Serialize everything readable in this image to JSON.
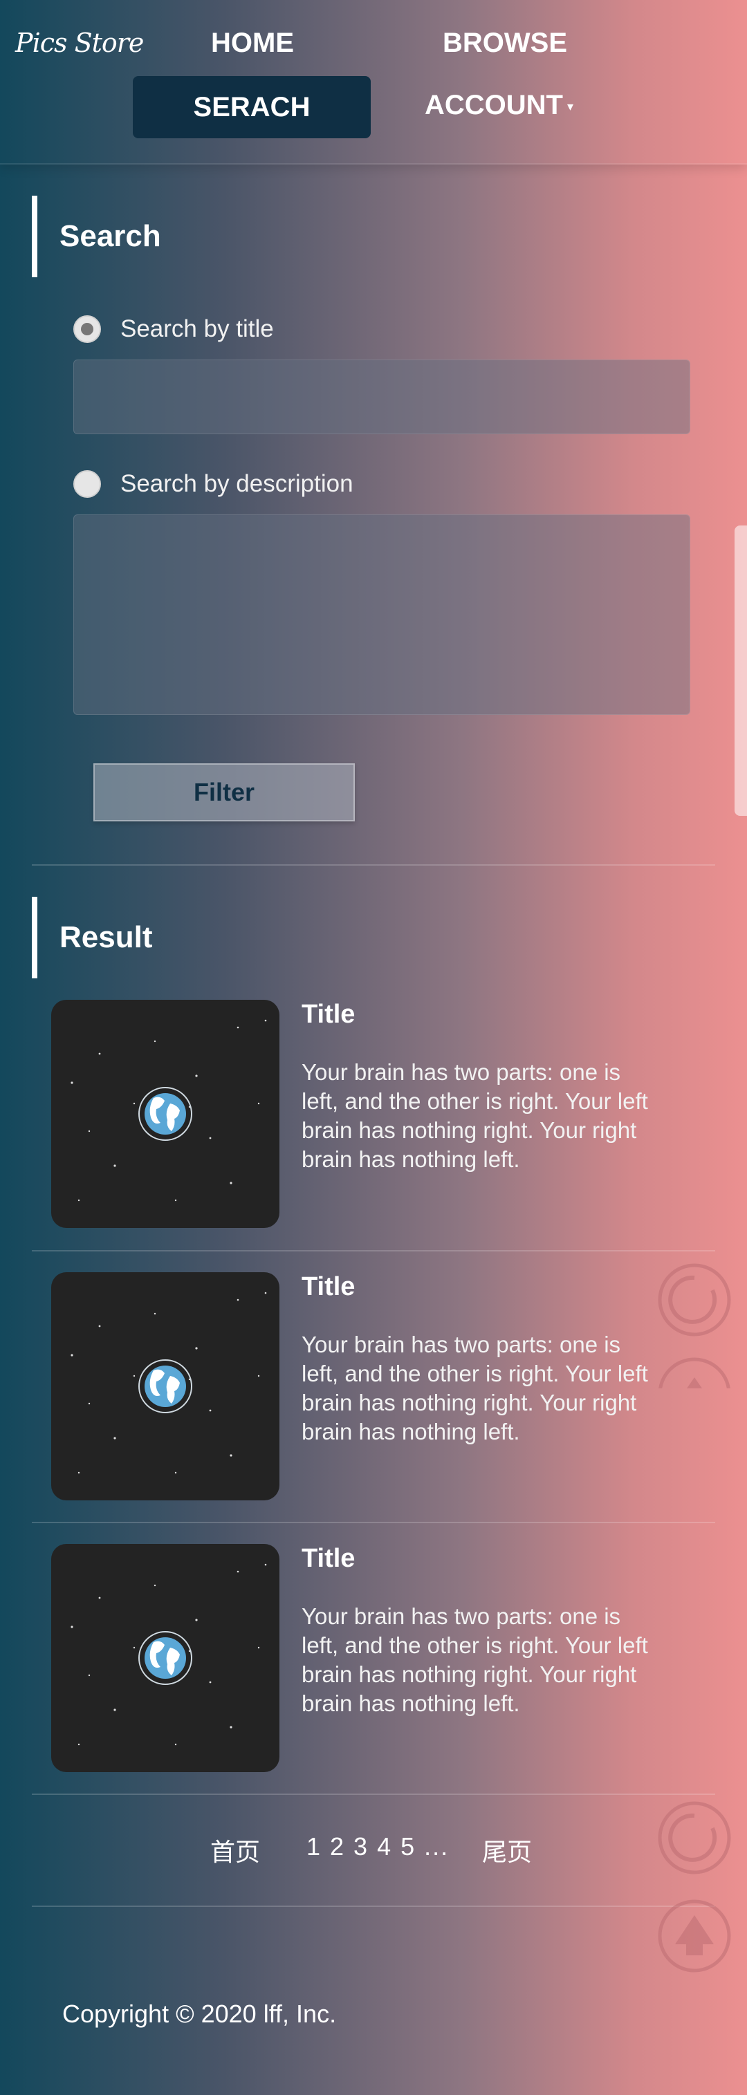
{
  "header": {
    "logo": "Pics Store",
    "nav": {
      "home": "HOME",
      "browse": "BROWSE",
      "search": "SERACH",
      "account": "ACCOUNT",
      "account_caret": "▾"
    }
  },
  "search": {
    "heading": "Search",
    "by_title_label": "Search by title",
    "by_title_checked": true,
    "title_value": "",
    "by_description_label": "Search by description",
    "by_description_checked": false,
    "description_value": "",
    "filter_label": "Filter"
  },
  "result": {
    "heading": "Result",
    "items": [
      {
        "title": "Title",
        "description": "Your brain has two parts: one is left, and the other is right. Your left brain has nothing right. Your right brain has nothing left."
      },
      {
        "title": "Title",
        "description": "Your brain has two parts: one is left, and the other is right. Your left brain has nothing right. Your right brain has nothing left."
      },
      {
        "title": "Title",
        "description": "Your brain has two parts: one is left, and the other is right. Your left brain has nothing right. Your right brain has nothing left."
      }
    ]
  },
  "pagination": {
    "first": "首页",
    "pages": "1 2 3 4 5 ...",
    "last": "尾页"
  },
  "footer": {
    "copyright": "Copyright © 2020 lff, Inc."
  },
  "icons": {
    "thumbnail": "earth-in-space-icon",
    "refresh": "refresh-circle-icon",
    "back_to_top": "up-arrow-circle-icon"
  },
  "colors": {
    "gradient_left": "#13485c",
    "gradient_right": "#ec9090",
    "active_nav": "#0f2f44",
    "thumbnail_bg": "#232323",
    "earth_blue": "#5aa7d6"
  }
}
